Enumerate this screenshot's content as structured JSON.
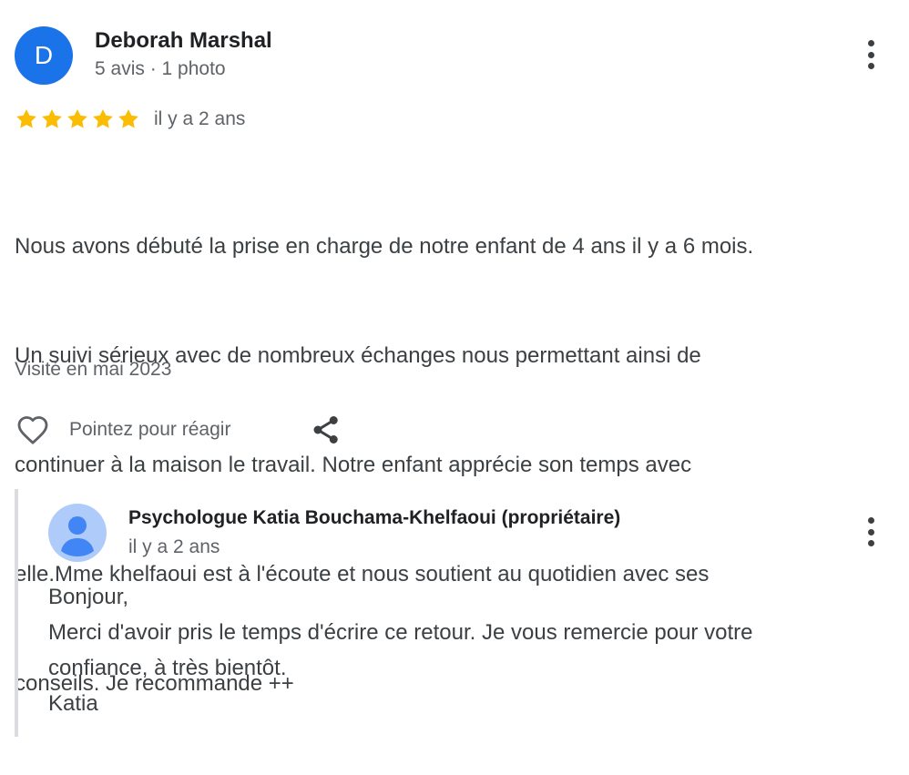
{
  "review": {
    "author": {
      "initial": "D",
      "name": "Deborah Marshal",
      "meta": "5 avis · 1 photo",
      "avatar_color": "#1a73e8"
    },
    "rating": {
      "stars": 5,
      "max_stars": 5,
      "star_color": "#fbbc04",
      "time": "il y a 2 ans"
    },
    "text_lines": [
      "Nous avons débuté la prise en charge de notre enfant de 4 ans il y a 6 mois.",
      "Un suivi sérieux avec de nombreux échanges nous permettant ainsi de",
      "continuer à la maison le travail. Notre enfant apprécie son temps avec",
      "elle.Mme khelfaoui est à l'écoute et nous soutient au quotidien avec ses",
      "conseils. Je recommande ++"
    ],
    "visited": "Visité en mai 2023",
    "react_label": "Pointez pour réagir",
    "icons": {
      "more": "more-vert-icon",
      "heart": "heart-outline-icon",
      "share": "share-icon"
    }
  },
  "owner_reply": {
    "name": "Psychologue Katia Bouchama-Khelfaoui (propriétaire)",
    "time": "il y a 2 ans",
    "avatar_icon": "person-avatar-icon",
    "avatar_color": "#aecbfa",
    "text_lines": [
      "Bonjour,",
      "Merci d'avoir pris le temps d'écrire ce retour. Je vous remercie pour votre",
      "confiance, à très bientôt.",
      "Katia"
    ]
  }
}
